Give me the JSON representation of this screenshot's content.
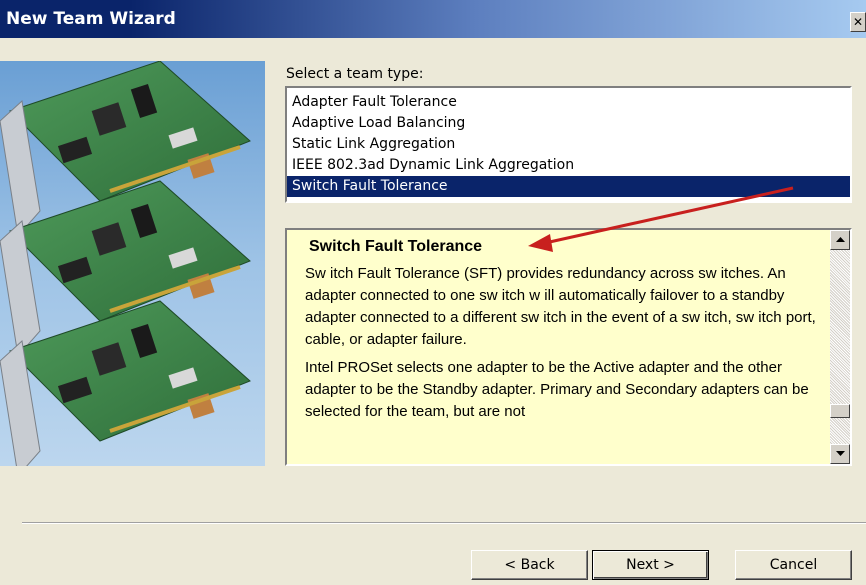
{
  "window": {
    "title": "New Team Wizard",
    "close_glyph": "✕",
    "titlebar_color": "#0a246a"
  },
  "team_type": {
    "label": "Select a team type:",
    "items": [
      "Adapter Fault Tolerance",
      "Adaptive Load Balancing",
      "Static Link Aggregation",
      "IEEE 802.3ad Dynamic Link Aggregation",
      "Switch Fault Tolerance"
    ],
    "selected": "Switch Fault Tolerance",
    "selected_color": "#0a246a"
  },
  "description": {
    "title": "Switch Fault Tolerance",
    "paragraphs": [
      "Sw itch Fault Tolerance (SFT) provides redundancy across sw itches. An adapter connected to one sw itch w ill automatically failover to a standby adapter connected to a different sw itch in the event of a sw itch, sw itch port, cable, or adapter failure.",
      "Intel PROSet selects one adapter to be the Active adapter and the other adapter to be the Standby adapter. Primary and Secondary adapters can be selected for the team, but are not"
    ],
    "background": "#ffffcc"
  },
  "annotation": {
    "arrow_color": "#c8201e"
  },
  "buttons": {
    "back": "< Back",
    "next": "Next >",
    "cancel": "Cancel"
  },
  "icons": {
    "close": "close-icon",
    "scroll_up": "scroll-up-icon",
    "scroll_down": "scroll-down-icon"
  }
}
